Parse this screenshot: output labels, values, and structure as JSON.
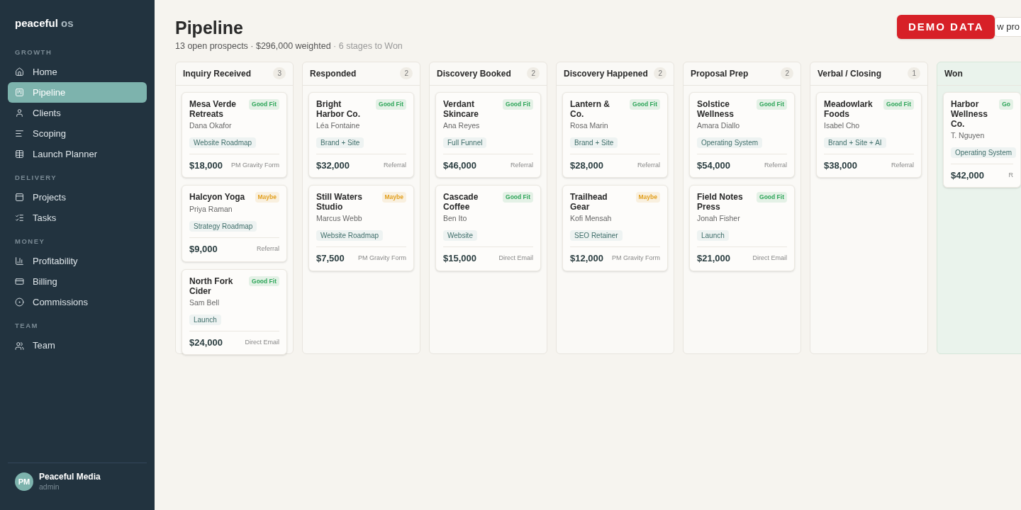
{
  "sidebar": {
    "logo": {
      "brand": "peaceful",
      "suffix": "os"
    },
    "sections": [
      {
        "title": "GROWTH",
        "items": [
          {
            "label": "Home",
            "selected": false
          },
          {
            "label": "Pipeline",
            "selected": true
          },
          {
            "label": "Clients",
            "selected": false
          },
          {
            "label": "Scoping",
            "selected": false
          },
          {
            "label": "Launch Planner",
            "selected": false
          }
        ]
      },
      {
        "title": "DELIVERY",
        "items": [
          {
            "label": "Projects",
            "selected": false
          },
          {
            "label": "Tasks",
            "selected": false
          }
        ]
      },
      {
        "title": "MONEY",
        "items": [
          {
            "label": "Profitability",
            "selected": false
          },
          {
            "label": "Billing",
            "selected": false
          },
          {
            "label": "Commissions",
            "selected": false
          }
        ]
      },
      {
        "title": "TEAM",
        "items": [
          {
            "label": "Team",
            "selected": false
          }
        ]
      }
    ],
    "user": {
      "initials": "PM",
      "name": "Peaceful Media",
      "role": "admin"
    }
  },
  "header": {
    "title": "Pipeline",
    "summary": "13 open prospects · $296,000 weighted",
    "summary_muted": " · 6 stages to Won",
    "button": "w pro",
    "badge": "DEMO DATA"
  },
  "columns": [
    {
      "title": "Inquiry Received",
      "count": "3",
      "kind": "open",
      "cards": [
        {
          "company": "Mesa Verde Retreats",
          "contact": "Dana Okafor",
          "fit": {
            "label": "Good Fit",
            "color": "#2fa65a"
          },
          "tag": "Website Roadmap",
          "amount": "$18,000",
          "source": "PM Gravity Form"
        },
        {
          "company": "Halcyon Yoga",
          "contact": "Priya Raman",
          "fit": {
            "label": "Maybe",
            "color": "#e2a020"
          },
          "tag": "Strategy Roadmap",
          "amount": "$9,000",
          "source": "Referral"
        },
        {
          "company": "North Fork Cider",
          "contact": "Sam Bell",
          "fit": {
            "label": "Good Fit",
            "color": "#2fa65a"
          },
          "tag": "Launch",
          "amount": "$24,000",
          "source": "Direct Email"
        }
      ]
    },
    {
      "title": "Responded",
      "count": "2",
      "kind": "open",
      "cards": [
        {
          "company": "Bright Harbor Co.",
          "contact": "Léa Fontaine",
          "fit": {
            "label": "Good Fit",
            "color": "#2fa65a"
          },
          "tag": "Brand + Site",
          "amount": "$32,000",
          "source": "Referral"
        },
        {
          "company": "Still Waters Studio",
          "contact": "Marcus Webb",
          "fit": {
            "label": "Maybe",
            "color": "#e2a020"
          },
          "tag": "Website Roadmap",
          "amount": "$7,500",
          "source": "PM Gravity Form"
        }
      ]
    },
    {
      "title": "Discovery Booked",
      "count": "2",
      "kind": "open",
      "cards": [
        {
          "company": "Verdant Skincare",
          "contact": "Ana Reyes",
          "fit": {
            "label": "Good Fit",
            "color": "#2fa65a"
          },
          "tag": "Full Funnel",
          "amount": "$46,000",
          "source": "Referral"
        },
        {
          "company": "Cascade Coffee",
          "contact": "Ben Ito",
          "fit": {
            "label": "Good Fit",
            "color": "#2fa65a"
          },
          "tag": "Website",
          "amount": "$15,000",
          "source": "Direct Email"
        }
      ]
    },
    {
      "title": "Discovery Happened",
      "count": "2",
      "kind": "open",
      "cards": [
        {
          "company": "Lantern & Co.",
          "contact": "Rosa Marin",
          "fit": {
            "label": "Good Fit",
            "color": "#2fa65a"
          },
          "tag": "Brand + Site",
          "amount": "$28,000",
          "source": "Referral"
        },
        {
          "company": "Trailhead Gear",
          "contact": "Kofi Mensah",
          "fit": {
            "label": "Maybe",
            "color": "#e2a020"
          },
          "tag": "SEO Retainer",
          "amount": "$12,000",
          "source": "PM Gravity Form"
        }
      ]
    },
    {
      "title": "Proposal Prep",
      "count": "2",
      "kind": "open",
      "cards": [
        {
          "company": "Solstice Wellness",
          "contact": "Amara Diallo",
          "fit": {
            "label": "Good Fit",
            "color": "#2fa65a"
          },
          "tag": "Operating System",
          "amount": "$54,000",
          "source": "Referral"
        },
        {
          "company": "Field Notes Press",
          "contact": "Jonah Fisher",
          "fit": {
            "label": "Good Fit",
            "color": "#2fa65a"
          },
          "tag": "Launch",
          "amount": "$21,000",
          "source": "Direct Email"
        }
      ]
    },
    {
      "title": "Verbal / Closing",
      "count": "1",
      "kind": "open",
      "cards": [
        {
          "company": "Meadowlark Foods",
          "contact": "Isabel Cho",
          "fit": {
            "label": "Good Fit",
            "color": "#2fa65a"
          },
          "tag": "Brand + Site + AI",
          "amount": "$38,000",
          "source": "Referral"
        }
      ]
    },
    {
      "title": "Won",
      "kind": "won",
      "cards": [
        {
          "company": "Harbor Wellness Co.",
          "contact": "T. Nguyen",
          "fit": {
            "label": "Go",
            "color": "#2fa65a"
          },
          "tag": "Operating System",
          "amount": "$42,000",
          "source": "R"
        }
      ]
    }
  ]
}
